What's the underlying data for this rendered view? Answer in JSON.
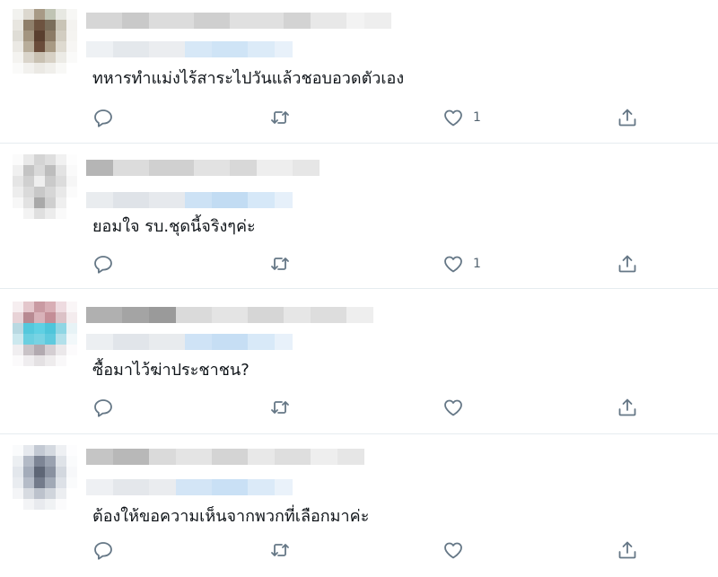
{
  "tweets": [
    {
      "text": "ทหารทำแม่งไร้สาระไปวันแล้วชอบอวดตัวเอง",
      "like_count": "1"
    },
    {
      "text": "ยอมใจ รบ.ชุดนี้จริงๆค่ะ",
      "like_count": "1"
    },
    {
      "text": "ซื้อมาไว้ฆ่าประชาชน?",
      "like_count": ""
    },
    {
      "text": "ต้องให้ขอความเห็นจากพวกที่เลือกมาค่ะ",
      "like_count": ""
    }
  ],
  "icons": {
    "reply": "reply-icon",
    "retweet": "retweet-icon",
    "like": "like-icon",
    "share": "share-icon"
  },
  "colors": {
    "icon": "#657786",
    "divider": "#e6ecf0",
    "text": "#0f1419"
  }
}
